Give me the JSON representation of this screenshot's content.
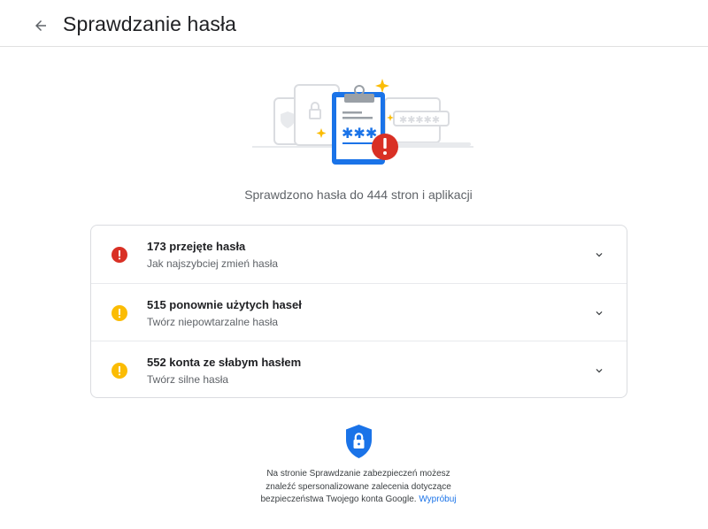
{
  "header": {
    "title": "Sprawdzanie hasła"
  },
  "summary": "Sprawdzono hasła do 444 stron i aplikacji",
  "issues": [
    {
      "title": "173 przejęte hasła",
      "subtitle": "Jak najszybciej zmień hasła",
      "severity": "compromised",
      "color": "#d93025"
    },
    {
      "title": "515 ponownie użytych haseł",
      "subtitle": "Twórz niepowtarzalne hasła",
      "severity": "warning",
      "color": "#fbbc04"
    },
    {
      "title": "552 konta ze słabym hasłem",
      "subtitle": "Twórz silne hasła",
      "severity": "warning",
      "color": "#fbbc04"
    }
  ],
  "footer": {
    "line1": "Na stronie Sprawdzanie zabezpieczeń możesz",
    "line2": "znaleźć spersonalizowane zalecenia dotyczące",
    "line3": "bezpieczeństwa Twojego konta Google.",
    "link": "Wypróbuj"
  },
  "colors": {
    "accent": "#1a73e8",
    "danger": "#d93025",
    "warning": "#fbbc04"
  }
}
